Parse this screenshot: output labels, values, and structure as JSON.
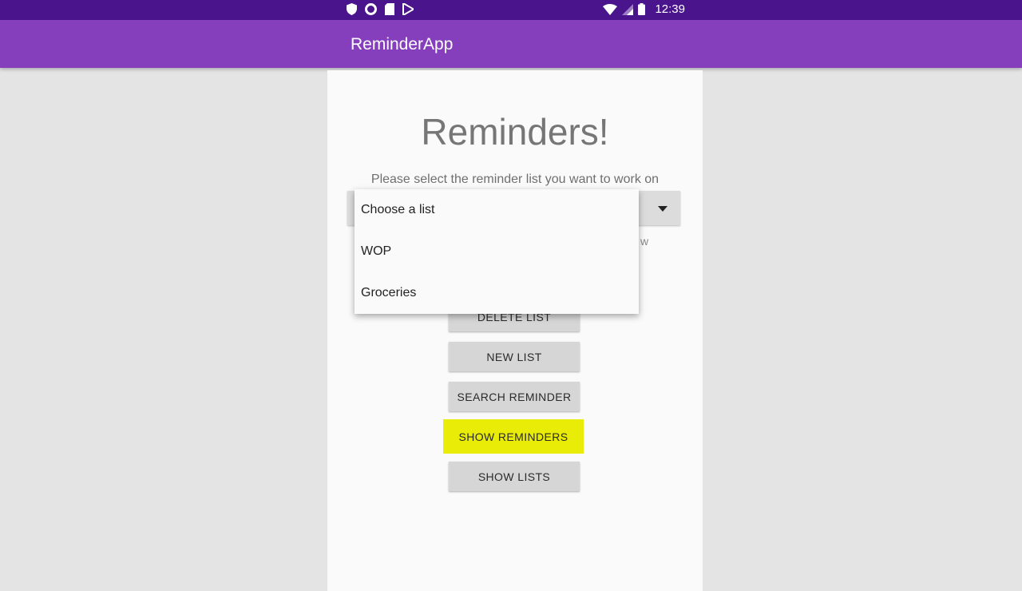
{
  "status_bar": {
    "time": "12:39",
    "left_icons": [
      "shield-icon",
      "circle-icon",
      "sd-card-icon",
      "play-store-icon"
    ],
    "right_icons": [
      "wifi-icon",
      "signal-icon",
      "battery-icon"
    ]
  },
  "app_bar": {
    "title": "ReminderApp"
  },
  "main": {
    "heading": "Reminders!",
    "instruction": "Please select the reminder list you want to work on",
    "partial_hidden_text": "w"
  },
  "spinner": {
    "options": [
      "Choose a list",
      "WOP",
      "Groceries"
    ]
  },
  "buttons": {
    "delete_list": "DELETE LIST",
    "new_list": "NEW LIST",
    "search_reminder": "SEARCH REMINDER",
    "show_reminders": "SHOW REMINDERS",
    "show_lists": "SHOW LISTS"
  },
  "colors": {
    "status_bar": "#4a148c",
    "app_bar": "#853fbc",
    "highlight": "#e9ec06"
  }
}
